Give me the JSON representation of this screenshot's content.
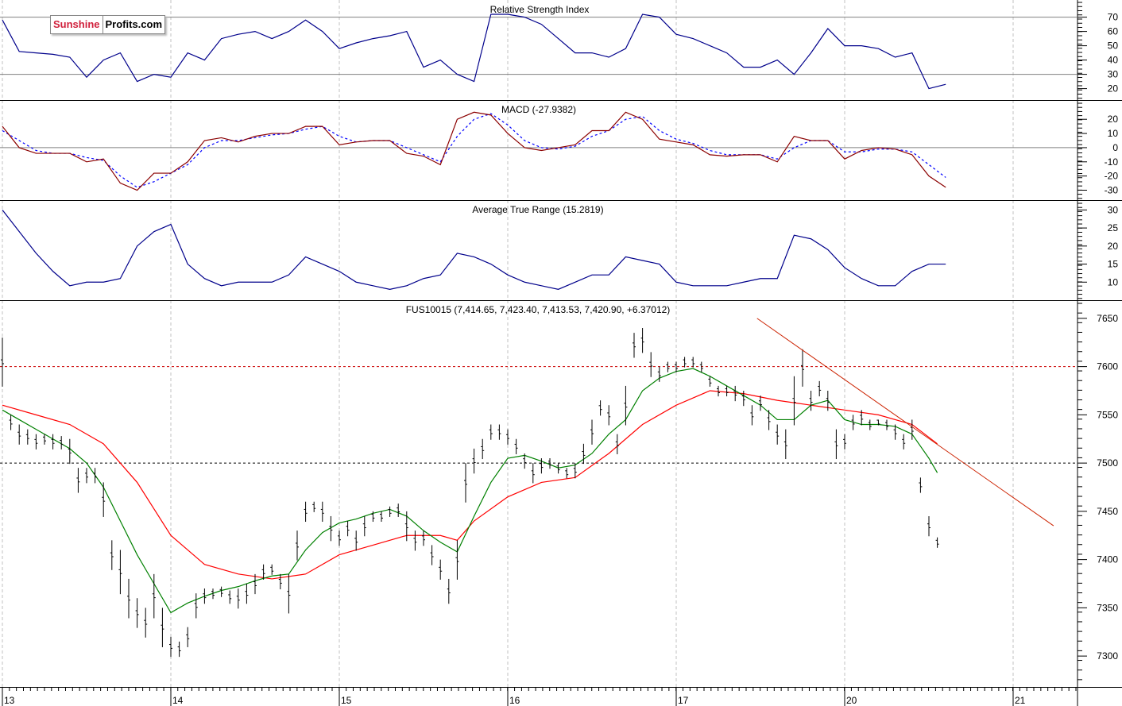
{
  "logo": {
    "part1": "Sunshine",
    "part2": "Profits.com"
  },
  "colors": {
    "rsi": "#00008b",
    "macd": "#8b0000",
    "signal": "#0000ff",
    "atr": "#00008b",
    "price": "#000000",
    "ma_fast": "#008000",
    "ma_slow": "#ff0000",
    "trendline": "#cc2200"
  },
  "chart_data": [
    {
      "type": "line",
      "title": "Relative Strength Index",
      "ylim": [
        12,
        82
      ],
      "yticks": [
        70,
        60,
        50,
        40,
        30,
        20
      ],
      "reference_lines": [
        70,
        30
      ],
      "t0": 0,
      "dt": 0.1,
      "values": [
        68,
        46,
        45,
        44,
        42,
        28,
        40,
        45,
        25,
        30,
        28,
        45,
        40,
        55,
        58,
        60,
        55,
        60,
        68,
        60,
        48,
        52,
        55,
        57,
        60,
        35,
        40,
        30,
        25,
        72,
        72,
        70,
        65,
        55,
        45,
        45,
        42,
        48,
        72,
        70,
        58,
        55,
        50,
        45,
        35,
        35,
        40,
        30,
        45,
        62,
        50,
        50,
        48,
        42,
        45,
        20,
        23
      ]
    },
    {
      "type": "line",
      "title": "MACD (-27.9382)",
      "ylim": [
        -37,
        33
      ],
      "yticks": [
        20,
        10,
        0,
        -10,
        -20,
        -30
      ],
      "reference_lines": [
        0
      ],
      "t0": 0,
      "dt": 0.1,
      "series": [
        {
          "name": "MACD",
          "values": [
            15,
            0,
            -4,
            -4,
            -4,
            -10,
            -8,
            -25,
            -30,
            -18,
            -18,
            -10,
            5,
            7,
            4,
            8,
            10,
            10,
            15,
            15,
            2,
            4,
            5,
            5,
            -4,
            -6,
            -12,
            20,
            25,
            23,
            10,
            0,
            -2,
            0,
            2,
            12,
            12,
            25,
            20,
            6,
            4,
            2,
            -5,
            -6,
            -5,
            -5,
            -10,
            8,
            5,
            5,
            -8,
            -2,
            0,
            -1,
            -5,
            -20,
            -28
          ]
        },
        {
          "name": "Signal",
          "values": [
            12,
            5,
            -2,
            -4,
            -4,
            -7,
            -9,
            -20,
            -28,
            -24,
            -18,
            -12,
            0,
            5,
            5,
            7,
            9,
            10,
            13,
            15,
            8,
            4,
            5,
            5,
            0,
            -5,
            -10,
            8,
            20,
            24,
            16,
            5,
            0,
            -1,
            1,
            8,
            12,
            20,
            22,
            12,
            6,
            3,
            -2,
            -5,
            -5,
            -5,
            -8,
            0,
            5,
            5,
            -3,
            -3,
            -1,
            -1,
            -3,
            -12,
            -21
          ]
        }
      ]
    },
    {
      "type": "line",
      "title": "Average True Range (15.2819)",
      "ylim": [
        5,
        32.5
      ],
      "yticks": [
        30,
        25,
        20,
        15,
        10
      ],
      "t0": 0,
      "dt": 0.1,
      "values": [
        30,
        24,
        18,
        13,
        9,
        10,
        10,
        11,
        20,
        24,
        26,
        15,
        11,
        9,
        10,
        10,
        10,
        12,
        17,
        15,
        13,
        10,
        9,
        8,
        9,
        11,
        12,
        18,
        17,
        15,
        12,
        10,
        9,
        8,
        10,
        12,
        12,
        17,
        16,
        15,
        10,
        9,
        9,
        9,
        10,
        11,
        11,
        23,
        22,
        19,
        14,
        11,
        9,
        9,
        13,
        15,
        15
      ]
    },
    {
      "type": "bar",
      "title": "FUS10015 (7,414.65, 7,423.40, 7,413.53, 7,420.90, +6.37012)",
      "ylim": [
        7268,
        7668
      ],
      "yticks": [
        7650,
        7600,
        7550,
        7500,
        7450,
        7400,
        7350,
        7300
      ],
      "xticks": [
        "13",
        "14",
        "15",
        "16",
        "17",
        "20",
        "21"
      ],
      "reference_lines": [
        {
          "value": 7600,
          "color": "#cc0000"
        },
        {
          "value": 7500,
          "color": "#000000"
        }
      ],
      "t0": 0,
      "dt": 0.05,
      "ohlc_low_high": [
        [
          7580,
          7630
        ],
        [
          7535,
          7550
        ],
        [
          7520,
          7540
        ],
        [
          7520,
          7535
        ],
        [
          7515,
          7530
        ],
        [
          7520,
          7530
        ],
        [
          7515,
          7530
        ],
        [
          7515,
          7528
        ],
        [
          7500,
          7525
        ],
        [
          7470,
          7495
        ],
        [
          7480,
          7495
        ],
        [
          7480,
          7495
        ],
        [
          7445,
          7480
        ],
        [
          7390,
          7420
        ],
        [
          7365,
          7410
        ],
        [
          7340,
          7380
        ],
        [
          7330,
          7360
        ],
        [
          7320,
          7350
        ],
        [
          7340,
          7385
        ],
        [
          7310,
          7350
        ],
        [
          7300,
          7320
        ],
        [
          7300,
          7315
        ],
        [
          7310,
          7330
        ],
        [
          7340,
          7365
        ],
        [
          7355,
          7370
        ],
        [
          7360,
          7370
        ],
        [
          7362,
          7372
        ],
        [
          7355,
          7368
        ],
        [
          7350,
          7370
        ],
        [
          7355,
          7375
        ],
        [
          7365,
          7385
        ],
        [
          7380,
          7395
        ],
        [
          7385,
          7395
        ],
        [
          7370,
          7385
        ],
        [
          7345,
          7385
        ],
        [
          7400,
          7430
        ],
        [
          7440,
          7460
        ],
        [
          7450,
          7460
        ],
        [
          7440,
          7460
        ],
        [
          7420,
          7445
        ],
        [
          7415,
          7430
        ],
        [
          7425,
          7440
        ],
        [
          7410,
          7430
        ],
        [
          7425,
          7445
        ],
        [
          7440,
          7450
        ],
        [
          7440,
          7450
        ],
        [
          7445,
          7455
        ],
        [
          7445,
          7458
        ],
        [
          7420,
          7450
        ],
        [
          7410,
          7430
        ],
        [
          7415,
          7430
        ],
        [
          7395,
          7415
        ],
        [
          7380,
          7400
        ],
        [
          7355,
          7380
        ],
        [
          7380,
          7420
        ],
        [
          7460,
          7500
        ],
        [
          7490,
          7515
        ],
        [
          7505,
          7525
        ],
        [
          7525,
          7540
        ],
        [
          7525,
          7540
        ],
        [
          7520,
          7535
        ],
        [
          7510,
          7525
        ],
        [
          7495,
          7510
        ],
        [
          7480,
          7500
        ],
        [
          7490,
          7505
        ],
        [
          7495,
          7505
        ],
        [
          7490,
          7500
        ],
        [
          7485,
          7495
        ],
        [
          7485,
          7500
        ],
        [
          7500,
          7520
        ],
        [
          7520,
          7545
        ],
        [
          7550,
          7565
        ],
        [
          7540,
          7560
        ],
        [
          7510,
          7530
        ],
        [
          7540,
          7580
        ],
        [
          7610,
          7635
        ],
        [
          7615,
          7640
        ],
        [
          7590,
          7615
        ],
        [
          7585,
          7600
        ],
        [
          7595,
          7605
        ],
        [
          7595,
          7605
        ],
        [
          7600,
          7610
        ],
        [
          7600,
          7610
        ],
        [
          7595,
          7605
        ],
        [
          7580,
          7590
        ],
        [
          7570,
          7580
        ],
        [
          7570,
          7580
        ],
        [
          7565,
          7580
        ],
        [
          7560,
          7575
        ],
        [
          7540,
          7560
        ],
        [
          7555,
          7570
        ],
        [
          7535,
          7555
        ],
        [
          7520,
          7540
        ],
        [
          7505,
          7535
        ],
        [
          7540,
          7590
        ],
        [
          7580,
          7618
        ],
        [
          7555,
          7575
        ],
        [
          7570,
          7585
        ],
        [
          7555,
          7575
        ],
        [
          7505,
          7535
        ],
        [
          7515,
          7530
        ],
        [
          7535,
          7550
        ],
        [
          7540,
          7555
        ],
        [
          7535,
          7545
        ],
        [
          7540,
          7545
        ],
        [
          7535,
          7545
        ],
        [
          7525,
          7540
        ],
        [
          7515,
          7530
        ],
        [
          7525,
          7545
        ],
        [
          7470,
          7485
        ],
        [
          7425,
          7445
        ],
        [
          7413,
          7423
        ]
      ],
      "ma_fast": [
        [
          0,
          7555
        ],
        [
          0.1,
          7545
        ],
        [
          0.2,
          7535
        ],
        [
          0.3,
          7525
        ],
        [
          0.4,
          7515
        ],
        [
          0.5,
          7500
        ],
        [
          0.6,
          7475
        ],
        [
          0.7,
          7440
        ],
        [
          0.8,
          7405
        ],
        [
          0.9,
          7375
        ],
        [
          1.0,
          7345
        ],
        [
          1.1,
          7355
        ],
        [
          1.2,
          7362
        ],
        [
          1.3,
          7368
        ],
        [
          1.4,
          7372
        ],
        [
          1.5,
          7378
        ],
        [
          1.6,
          7383
        ],
        [
          1.7,
          7385
        ],
        [
          1.8,
          7410
        ],
        [
          1.9,
          7428
        ],
        [
          2.0,
          7438
        ],
        [
          2.1,
          7442
        ],
        [
          2.2,
          7448
        ],
        [
          2.3,
          7452
        ],
        [
          2.4,
          7445
        ],
        [
          2.5,
          7430
        ],
        [
          2.6,
          7418
        ],
        [
          2.7,
          7408
        ],
        [
          2.8,
          7445
        ],
        [
          2.9,
          7480
        ],
        [
          3.0,
          7505
        ],
        [
          3.1,
          7508
        ],
        [
          3.2,
          7502
        ],
        [
          3.3,
          7495
        ],
        [
          3.4,
          7498
        ],
        [
          3.5,
          7510
        ],
        [
          3.6,
          7530
        ],
        [
          3.7,
          7545
        ],
        [
          3.8,
          7575
        ],
        [
          3.9,
          7588
        ],
        [
          4.0,
          7595
        ],
        [
          4.1,
          7598
        ],
        [
          4.2,
          7590
        ],
        [
          4.3,
          7580
        ],
        [
          4.4,
          7570
        ],
        [
          4.5,
          7560
        ],
        [
          4.6,
          7545
        ],
        [
          4.7,
          7545
        ],
        [
          4.8,
          7560
        ],
        [
          4.9,
          7565
        ],
        [
          5.0,
          7545
        ],
        [
          5.1,
          7540
        ],
        [
          5.2,
          7540
        ],
        [
          5.3,
          7538
        ],
        [
          5.4,
          7530
        ],
        [
          5.5,
          7505
        ],
        [
          5.55,
          7490
        ]
      ],
      "ma_slow": [
        [
          0,
          7560
        ],
        [
          0.2,
          7550
        ],
        [
          0.4,
          7540
        ],
        [
          0.6,
          7520
        ],
        [
          0.8,
          7480
        ],
        [
          1.0,
          7425
        ],
        [
          1.2,
          7395
        ],
        [
          1.4,
          7385
        ],
        [
          1.6,
          7380
        ],
        [
          1.8,
          7385
        ],
        [
          2.0,
          7405
        ],
        [
          2.2,
          7415
        ],
        [
          2.4,
          7425
        ],
        [
          2.6,
          7425
        ],
        [
          2.7,
          7420
        ],
        [
          2.8,
          7440
        ],
        [
          3.0,
          7465
        ],
        [
          3.2,
          7480
        ],
        [
          3.4,
          7485
        ],
        [
          3.6,
          7510
        ],
        [
          3.8,
          7540
        ],
        [
          4.0,
          7560
        ],
        [
          4.2,
          7575
        ],
        [
          4.4,
          7572
        ],
        [
          4.6,
          7565
        ],
        [
          4.8,
          7560
        ],
        [
          5.0,
          7555
        ],
        [
          5.2,
          7550
        ],
        [
          5.4,
          7540
        ],
        [
          5.55,
          7520
        ]
      ],
      "trendline": [
        [
          4.48,
          7650
        ],
        [
          6.24,
          7435
        ]
      ]
    }
  ]
}
